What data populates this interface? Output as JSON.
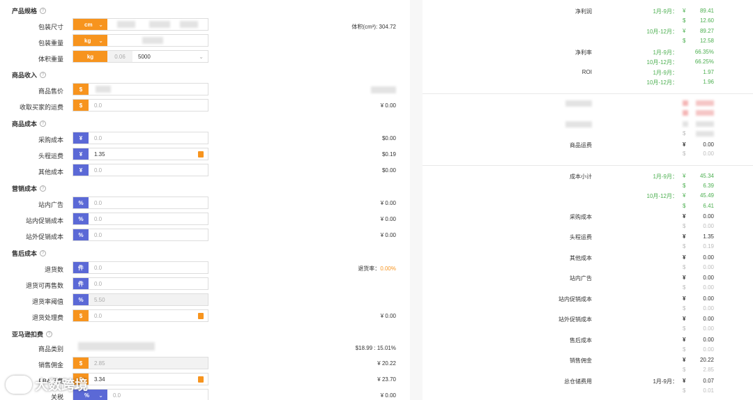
{
  "left": {
    "sections": {
      "spec": "产品规格",
      "income": "商品收入",
      "cost": "商品成本",
      "marketing": "营销成本",
      "aftersale": "售后成本",
      "amazon": "亚马逊扣费"
    },
    "rows": {
      "pack_size": {
        "label": "包装尺寸",
        "unit": "cm"
      },
      "pack_weight": {
        "label": "包装重量",
        "unit": "kg"
      },
      "vol_weight": {
        "label": "体积重量",
        "unit": "kg",
        "value1": "0.06",
        "value2": "5000"
      },
      "sale_price": {
        "label": "商品售价",
        "addon": "$"
      },
      "buyer_shipping": {
        "label": "收取买家的运费",
        "addon": "$",
        "value": "0.0",
        "result": "¥ 0.00"
      },
      "purchase_cost": {
        "label": "采购成本",
        "addon": "¥",
        "value": "0.0",
        "result": "$0.00"
      },
      "first_leg": {
        "label": "头程运费",
        "addon": "¥",
        "value": "1.35",
        "result": "$0.19"
      },
      "other_cost": {
        "label": "其他成本",
        "addon": "¥",
        "value": "0.0",
        "result": "$0.00"
      },
      "onsite_ads": {
        "label": "站内广告",
        "addon": "%",
        "value": "0.0",
        "result": "¥ 0.00"
      },
      "onsite_promo": {
        "label": "站内促销成本",
        "addon": "%",
        "value": "0.0",
        "result": "¥ 0.00"
      },
      "offsite_promo": {
        "label": "站外促销成本",
        "addon": "%",
        "value": "0.0",
        "result": "¥ 0.00"
      },
      "returns": {
        "label": "退货数",
        "addon": "件",
        "value": "0.0",
        "result_label": "退货率：",
        "result_value": "0.00%"
      },
      "returns_resellable": {
        "label": "退货可再售数",
        "addon": "件",
        "value": "0.0"
      },
      "return_threshold": {
        "label": "退货率阈值",
        "addon": "%",
        "value": "5.50"
      },
      "return_handling": {
        "label": "退货处理费",
        "addon": "$",
        "value": "0.0",
        "result": "¥ 0.00"
      },
      "category": {
        "label": "商品类别",
        "result": "$18.99 : 15.01%"
      },
      "sales_commission": {
        "label": "销售佣金",
        "addon": "$",
        "value": "2.85",
        "result": "¥ 20.22"
      },
      "fba_fee": {
        "label": "FBA运费",
        "addon": "$",
        "value": "3.34",
        "result": "¥ 23.70"
      },
      "tariff": {
        "label": "关税",
        "addon": "%",
        "value": "0.0",
        "result": "¥ 0.00"
      }
    },
    "volume_label": "体积(cm³): 304.72"
  },
  "right": {
    "net_profit": {
      "label": "净利润",
      "period1": "1月-9月：",
      "p1_cny": "89.41",
      "p1_usd": "12.60",
      "period2": "10月-12月：",
      "p2_cny": "89.27",
      "p2_usd": "12.58"
    },
    "net_margin": {
      "label": "净利率",
      "period1": "1月-9月：",
      "p1": "66.35%",
      "period2": "10月-12月：",
      "p2": "66.25%"
    },
    "roi": {
      "label": "ROI",
      "period1": "1月-9月：",
      "p1": "1.97",
      "period2": "10月-12月：",
      "p2": "1.96"
    },
    "shipping": {
      "label": "商品运费",
      "cny": "0.00",
      "usd": "0.00"
    },
    "cost_subtotal": {
      "label": "成本小计",
      "period1": "1月-9月：",
      "p1_cny": "45.34",
      "p1_usd": "6.39",
      "period2": "10月-12月：",
      "p2_cny": "45.49",
      "p2_usd": "6.41"
    },
    "items": [
      {
        "label": "采购成本",
        "cny": "0.00",
        "usd": "0.00"
      },
      {
        "label": "头程运费",
        "cny": "1.35",
        "usd": "0.19"
      },
      {
        "label": "其他成本",
        "cny": "0.00",
        "usd": "0.00"
      },
      {
        "label": "站内广告",
        "cny": "0.00",
        "usd": "0.00"
      },
      {
        "label": "站内促销成本",
        "cny": "0.00",
        "usd": "0.00"
      },
      {
        "label": "站外促销成本",
        "cny": "0.00",
        "usd": "0.00"
      },
      {
        "label": "售后成本",
        "cny": "0.00",
        "usd": "0.00"
      },
      {
        "label": "销售佣金",
        "cny": "20.22",
        "usd": "2.85"
      }
    ],
    "storage": {
      "label": "总仓储费用",
      "period1": "1月-9月：",
      "cny": "0.07",
      "usd": "0.01"
    },
    "cny_symbol": "¥",
    "usd_symbol": "$"
  },
  "watermark": "大数跨境",
  "colors": {
    "orange": "#f7941e",
    "purple": "#5b69d6",
    "green": "#4caf50"
  }
}
